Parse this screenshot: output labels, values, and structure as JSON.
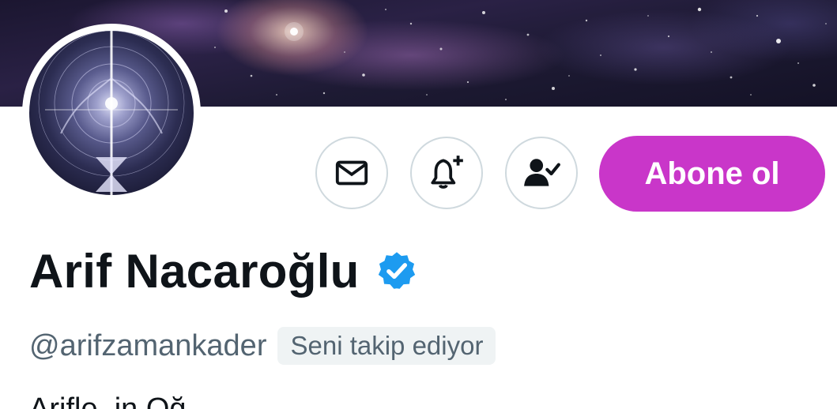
{
  "profile": {
    "display_name": "Arif Nacaroğlu",
    "handle": "@arifzamankader",
    "follows_you_badge": "Seni takip ediyor",
    "bio_partial": "Arifle..in Oğ..."
  },
  "actions": {
    "subscribe_label": "Abone ol",
    "message_icon": "envelope-icon",
    "notify_icon": "bell-plus-icon",
    "following_icon": "person-check-icon"
  },
  "colors": {
    "subscribe_bg": "#c936c9",
    "verified_blue": "#1d9bf0",
    "text_primary": "#0f1419",
    "text_secondary": "#536471"
  }
}
